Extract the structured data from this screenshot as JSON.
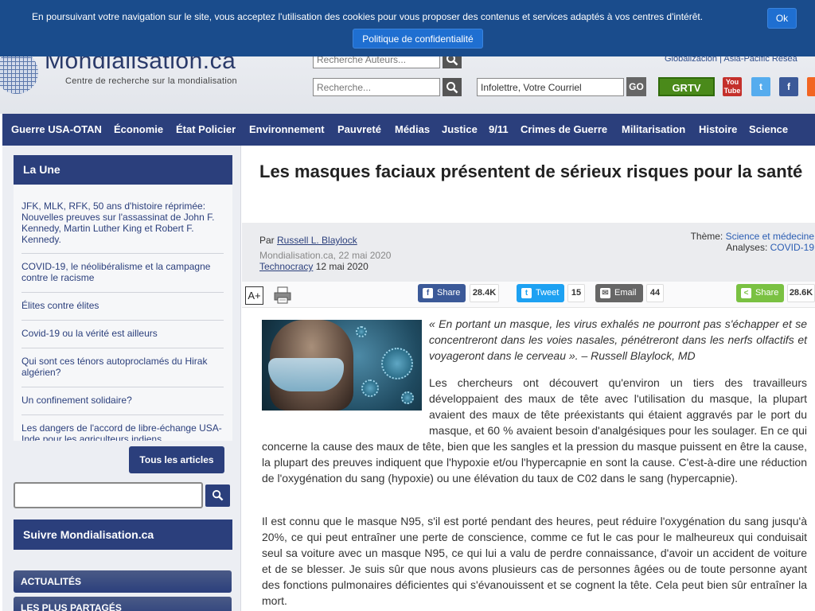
{
  "cookie": {
    "text": "En poursuivant votre navigation sur le site, vous acceptez l'utilisation des cookies pour vous proposer des contenus et services adaptés à vos centres d'intérêt.",
    "ok_label": "Ok",
    "policy_label": "Politique de confidentialité"
  },
  "header": {
    "logo": "Mondialisation.ca",
    "tagline": "Centre de recherche sur la mondialisation",
    "author_search_placeholder": "Recherche Auteurs...",
    "search_placeholder": "Recherche...",
    "newsletter_placeholder": "Infolettre, Votre Courriel",
    "go_label": "GO",
    "top_links": "Globalización | Asia-Pacific Resea",
    "grtv_label": "GRTV"
  },
  "nav": {
    "items": [
      "Guerre USA-OTAN",
      "Économie",
      "État Policier",
      "Environnement",
      "Pauvreté",
      "Médias",
      "Justice",
      "9/11",
      "Crimes de Guerre",
      "Militarisation",
      "Histoire",
      "Science"
    ]
  },
  "sidebar": {
    "la_une_title": "La Une",
    "items": [
      "JFK, MLK, RFK, 50 ans d'histoire réprimée: Nouvelles preuves sur l'assassinat de John F. Kennedy, Martin Luther King et Robert F. Kennedy.",
      "COVID-19, le néolibéralisme et la campagne contre le racisme",
      "Élites contre élites",
      "Covid-19 ou la vérité est ailleurs",
      "Qui sont ces ténors autoproclamés du Hirak algérien?",
      "Un confinement solidaire?",
      "Les dangers de l'accord de libre-échange USA-Inde pour les agriculteurs indiens"
    ],
    "all_articles_label": "Tous les articles",
    "follow_title": "Suivre Mondialisation.ca",
    "tabs": [
      "ACTUALITÉS",
      "LES PLUS PARTAGÉS"
    ]
  },
  "article": {
    "title": "Les masques faciaux présentent de sérieux risques pour la santé",
    "by_prefix": "Par ",
    "author": "Russell L. Blaylock",
    "source_date": "Mondialisation.ca, 22 mai 2020",
    "origin_link": "Technocracy",
    "origin_date": " 12 mai 2020",
    "theme_label": "Thème: ",
    "theme_value": "Science et médecine",
    "analyses_label": "Analyses: ",
    "analyses_value": "COVID-19",
    "font_icon_label": "A+",
    "share": {
      "facebook_label": "Share",
      "facebook_count": "28.4K",
      "twitter_label": "Tweet",
      "twitter_count": "15",
      "email_label": "Email",
      "email_count": "44",
      "share_label": "Share",
      "share_count": "28.6K"
    },
    "quote": "« En portant un masque, les virus exhalés ne pourront pas s'échapper et se concentreront dans les voies nasales, pénétreront dans les nerfs olfactifs et voyageront dans le cerveau ».",
    "quote_attr": " – Russell Blaylock, MD",
    "para1": "Les chercheurs ont découvert qu'environ un tiers des travailleurs développaient des maux de tête avec l'utilisation du masque, la plupart avaient des maux de tête préexistants qui étaient aggravés par le port du masque, et 60 % avaient besoin d'analgésiques pour les soulager. En ce qui concerne la cause des maux de tête, bien que les sangles et la pression du masque puissent en être la cause, la plupart des preuves indiquent que l'hypoxie et/ou l'hypercapnie en sont la cause. C'est-à-dire une réduction de l'oxygénation du sang (hypoxie) ou une élévation du taux de C02 dans le sang (hypercapnie).",
    "para2": "Il est connu que le masque N95, s'il est porté pendant des heures, peut réduire l'oxygénation du sang jusqu'à 20%, ce qui peut entraîner une perte de conscience, comme ce fut le cas pour le malheureux qui conduisait seul sa voiture avec un masque N95, ce qui lui a valu de perdre connaissance, d'avoir un accident de voiture et de se blesser. Je suis sûr que nous avons plusieurs cas de personnes âgées ou de toute personne ayant des fonctions pulmonaires déficientes qui s'évanouissent et se cognent la tête. Cela peut bien sûr entraîner la mort."
  },
  "colors": {
    "brand": "#2b3f7c",
    "cookie_bg": "#1a4c8c",
    "facebook": "#3b5998",
    "twitter": "#1da1f2",
    "email": "#666666",
    "share_green": "#7ac142"
  }
}
